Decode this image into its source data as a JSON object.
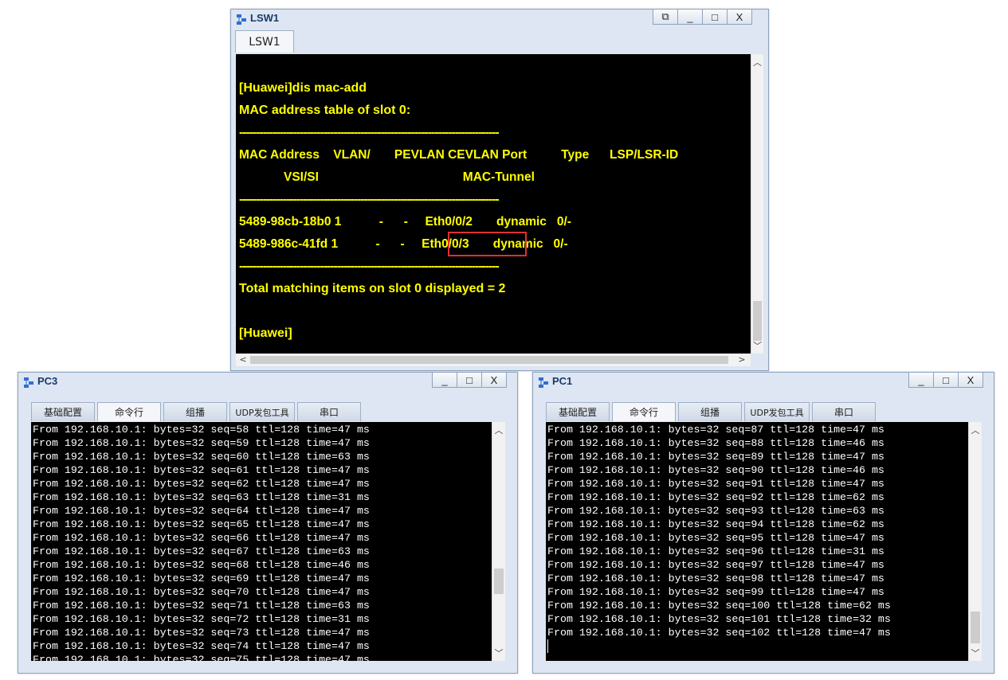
{
  "lsw1": {
    "title": "LSW1",
    "tab": "LSW1",
    "console": [
      "[Huawei]dis mac-add",
      "MAC address table of slot 0:",
      "-----------------------------------------------------------------------------",
      "MAC Address    VLAN/       PEVLAN CEVLAN Port          Type      LSP/LSR-ID",
      "             VSI/SI                                          MAC-Tunnel",
      "-----------------------------------------------------------------------------",
      "5489-98cb-18b0 1           -      -     Eth0/0/2       dynamic   0/-",
      "5489-986c-41fd 1           -      -     Eth0/0/3       dynamic   0/-",
      "-----------------------------------------------------------------------------",
      "Total matching items on slot 0 displayed = 2",
      "",
      "[Huawei]"
    ]
  },
  "pc3": {
    "title": "PC3",
    "tabs": [
      "基础配置",
      "命令行",
      "组播",
      "UDP发包工具",
      "串口"
    ],
    "lines": [
      "From 192.168.10.1: bytes=32 seq=58 ttl=128 time=47 ms",
      "From 192.168.10.1: bytes=32 seq=59 ttl=128 time=47 ms",
      "From 192.168.10.1: bytes=32 seq=60 ttl=128 time=63 ms",
      "From 192.168.10.1: bytes=32 seq=61 ttl=128 time=47 ms",
      "From 192.168.10.1: bytes=32 seq=62 ttl=128 time=47 ms",
      "From 192.168.10.1: bytes=32 seq=63 ttl=128 time=31 ms",
      "From 192.168.10.1: bytes=32 seq=64 ttl=128 time=47 ms",
      "From 192.168.10.1: bytes=32 seq=65 ttl=128 time=47 ms",
      "From 192.168.10.1: bytes=32 seq=66 ttl=128 time=47 ms",
      "From 192.168.10.1: bytes=32 seq=67 ttl=128 time=63 ms",
      "From 192.168.10.1: bytes=32 seq=68 ttl=128 time=46 ms",
      "From 192.168.10.1: bytes=32 seq=69 ttl=128 time=47 ms",
      "From 192.168.10.1: bytes=32 seq=70 ttl=128 time=47 ms",
      "From 192.168.10.1: bytes=32 seq=71 ttl=128 time=63 ms",
      "From 192.168.10.1: bytes=32 seq=72 ttl=128 time=31 ms",
      "From 192.168.10.1: bytes=32 seq=73 ttl=128 time=47 ms",
      "From 192.168.10.1: bytes=32 seq=74 ttl=128 time=47 ms",
      "From 192.168.10.1: bytes=32 seq=75 ttl=128 time=47 ms"
    ]
  },
  "pc1": {
    "title": "PC1",
    "tabs": [
      "基础配置",
      "命令行",
      "组播",
      "UDP发包工具",
      "串口"
    ],
    "lines": [
      "From 192.168.10.1: bytes=32 seq=87 ttl=128 time=47 ms",
      "From 192.168.10.1: bytes=32 seq=88 ttl=128 time=46 ms",
      "From 192.168.10.1: bytes=32 seq=89 ttl=128 time=47 ms",
      "From 192.168.10.1: bytes=32 seq=90 ttl=128 time=46 ms",
      "From 192.168.10.1: bytes=32 seq=91 ttl=128 time=47 ms",
      "From 192.168.10.1: bytes=32 seq=92 ttl=128 time=62 ms",
      "From 192.168.10.1: bytes=32 seq=93 ttl=128 time=63 ms",
      "From 192.168.10.1: bytes=32 seq=94 ttl=128 time=62 ms",
      "From 192.168.10.1: bytes=32 seq=95 ttl=128 time=47 ms",
      "From 192.168.10.1: bytes=32 seq=96 ttl=128 time=31 ms",
      "From 192.168.10.1: bytes=32 seq=97 ttl=128 time=47 ms",
      "From 192.168.10.1: bytes=32 seq=98 ttl=128 time=47 ms",
      "From 192.168.10.1: bytes=32 seq=99 ttl=128 time=47 ms",
      "From 192.168.10.1: bytes=32 seq=100 ttl=128 time=62 ms",
      "From 192.168.10.1: bytes=32 seq=101 ttl=128 time=32 ms",
      "From 192.168.10.1: bytes=32 seq=102 ttl=128 time=47 ms"
    ]
  },
  "controls": {
    "restore": "⧉",
    "minimize": "_",
    "maximize": "□",
    "close": "X"
  },
  "icons": {
    "window": "network-device-icon"
  }
}
